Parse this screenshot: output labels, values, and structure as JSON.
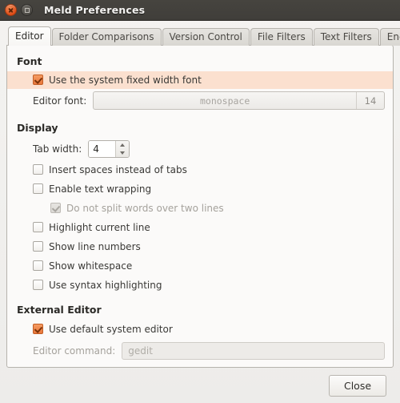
{
  "window": {
    "title": "Meld Preferences",
    "buttons": {
      "close": "close-icon",
      "maximize": "maximize-icon"
    }
  },
  "tabs": [
    {
      "label": "Editor",
      "active": true
    },
    {
      "label": "Folder Comparisons",
      "active": false
    },
    {
      "label": "Version Control",
      "active": false
    },
    {
      "label": "File Filters",
      "active": false
    },
    {
      "label": "Text Filters",
      "active": false
    },
    {
      "label": "Encoding",
      "active": false
    }
  ],
  "sections": {
    "font": {
      "title": "Font",
      "use_system_font": {
        "label": "Use the system fixed width font",
        "checked": true,
        "highlighted": true
      },
      "editor_font": {
        "label": "Editor font:",
        "family": "monospace",
        "size": "14"
      }
    },
    "display": {
      "title": "Display",
      "tab_width": {
        "label": "Tab width:",
        "value": "4"
      },
      "options": [
        {
          "label": "Insert spaces instead of tabs",
          "checked": false,
          "disabled": false,
          "indent": 1
        },
        {
          "label": "Enable text wrapping",
          "checked": false,
          "disabled": false,
          "indent": 1
        },
        {
          "label": "Do not split words over two lines",
          "checked": true,
          "disabled": true,
          "indent": 2
        },
        {
          "label": "Highlight current line",
          "checked": false,
          "disabled": false,
          "indent": 1
        },
        {
          "label": "Show line numbers",
          "checked": false,
          "disabled": false,
          "indent": 1
        },
        {
          "label": "Show whitespace",
          "checked": false,
          "disabled": false,
          "indent": 1
        },
        {
          "label": "Use syntax highlighting",
          "checked": false,
          "disabled": false,
          "indent": 1
        }
      ]
    },
    "external_editor": {
      "title": "External Editor",
      "use_default": {
        "label": "Use default system editor",
        "checked": true
      },
      "editor_command": {
        "label": "Editor command:",
        "value": "gedit"
      }
    }
  },
  "actions": {
    "close_label": "Close"
  },
  "colors": {
    "titlebar": "#403e3a",
    "accent": "#e8763a",
    "highlight_row": "#fbe0cf",
    "page_bg": "#fbfaf9",
    "dialog_bg": "#f2f1ef"
  }
}
